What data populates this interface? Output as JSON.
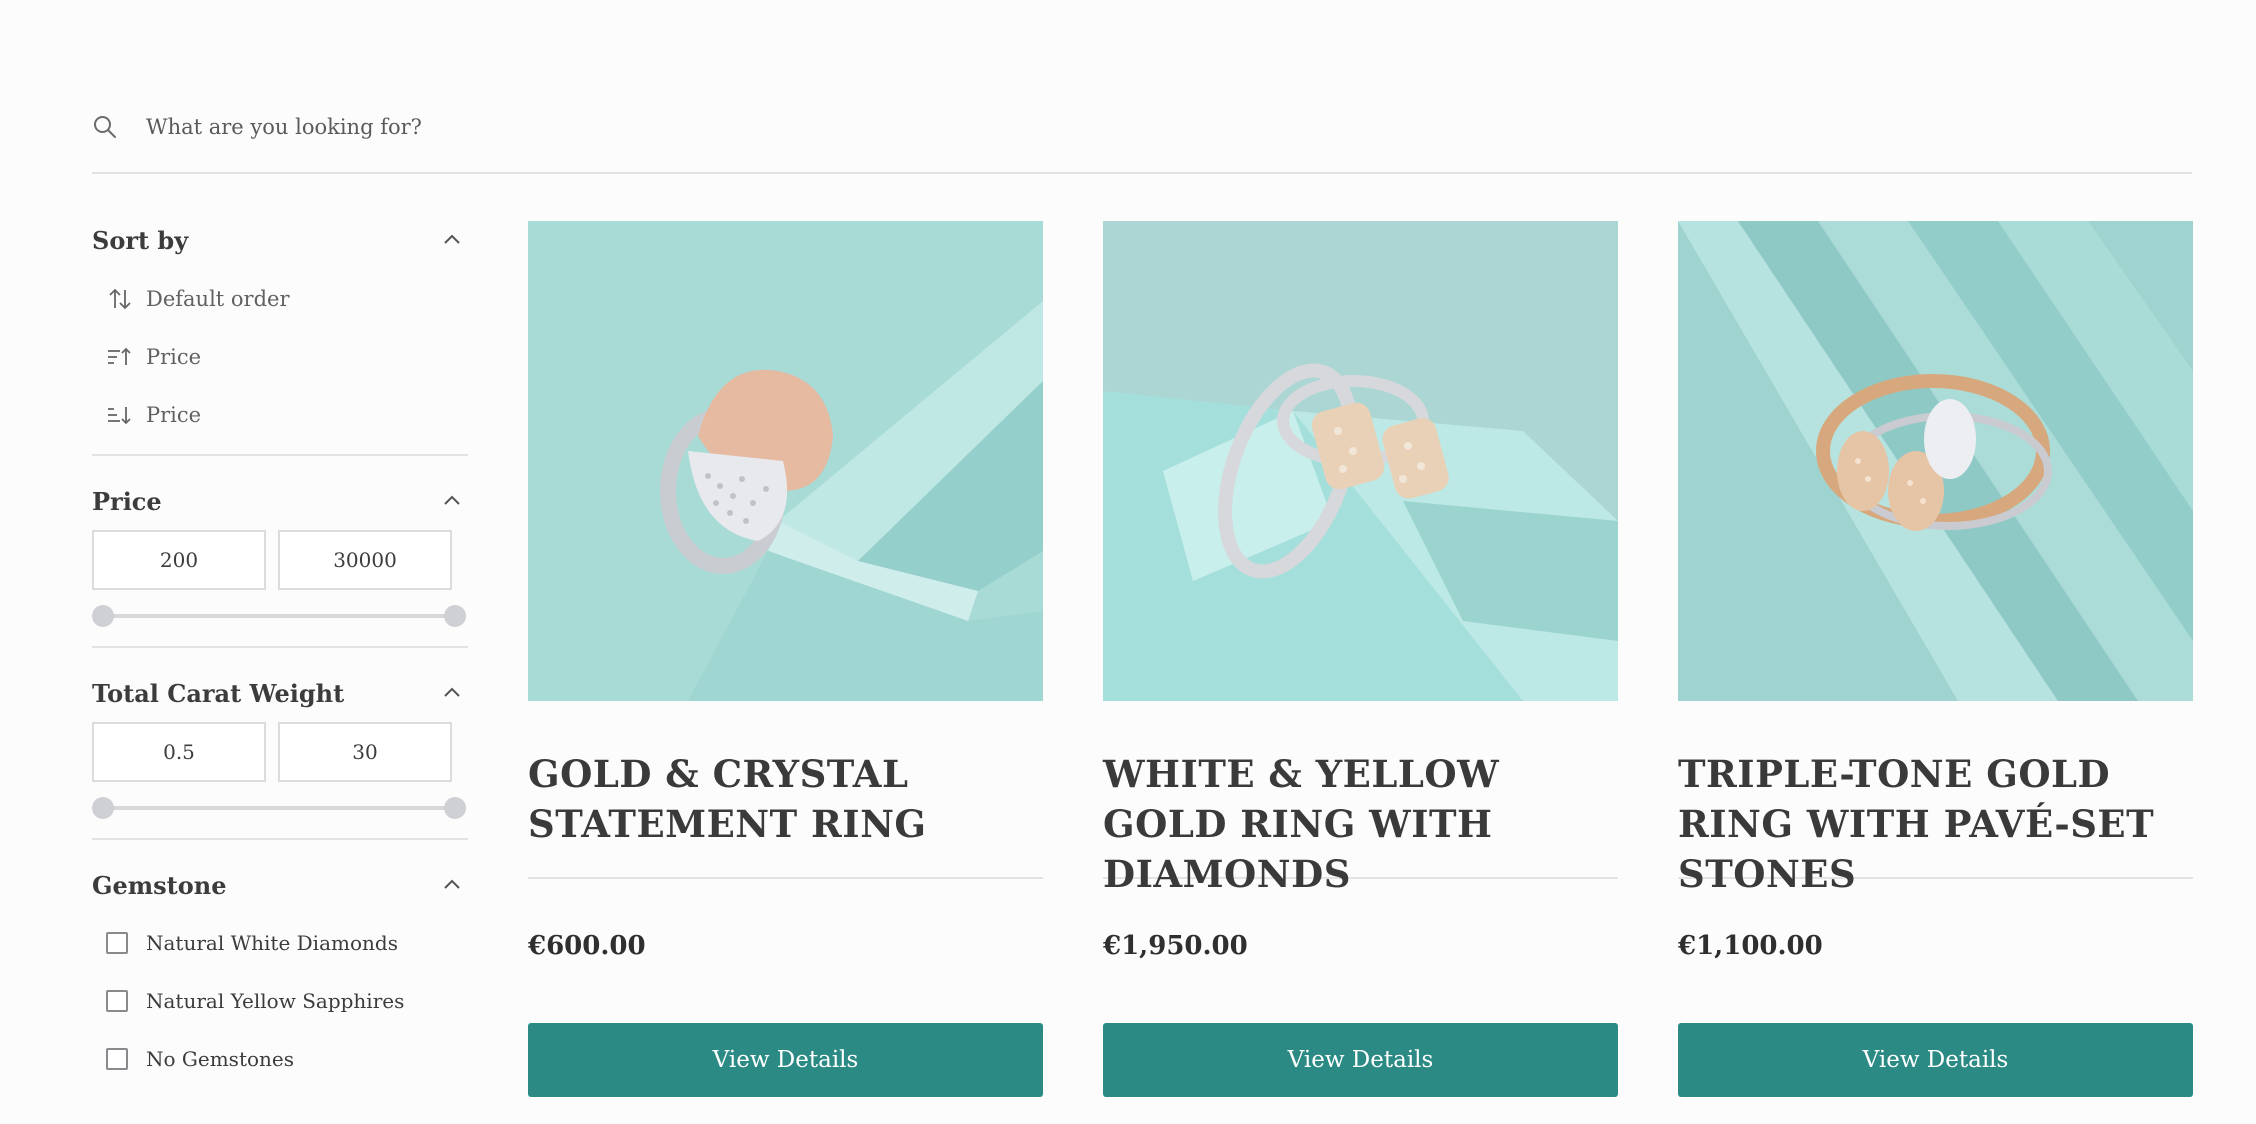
{
  "search": {
    "placeholder": "What are you looking for?"
  },
  "sidebar": {
    "sort": {
      "title": "Sort by",
      "items": [
        {
          "label": "Default order",
          "icon": "sort-arrows-icon"
        },
        {
          "label": "Price",
          "icon": "sort-ascending-icon"
        },
        {
          "label": "Price",
          "icon": "sort-descending-icon"
        }
      ]
    },
    "price": {
      "title": "Price",
      "min": "200",
      "max": "30000"
    },
    "carat": {
      "title": "Total Carat Weight",
      "min": "0.5",
      "max": "30"
    },
    "gemstone": {
      "title": "Gemstone",
      "options": [
        {
          "label": "Natural White Diamonds",
          "checked": false
        },
        {
          "label": "Natural Yellow Sapphires",
          "checked": false
        },
        {
          "label": "No Gemstones",
          "checked": false
        }
      ]
    }
  },
  "products": [
    {
      "title": "Gold & Crystal Statement Ring",
      "price": "€600.00",
      "button": "View Details"
    },
    {
      "title": "White & Yellow Gold Ring with Diamonds",
      "price": "€1,950.00",
      "button": "View Details"
    },
    {
      "title": "Triple-Tone Gold Ring with Pavé-Set Stones",
      "price": "€1,100.00",
      "button": "View Details"
    }
  ],
  "colors": {
    "accent": "#2b8a84",
    "background": "#fcfcfd",
    "image_bg": "#a9dcd8"
  }
}
